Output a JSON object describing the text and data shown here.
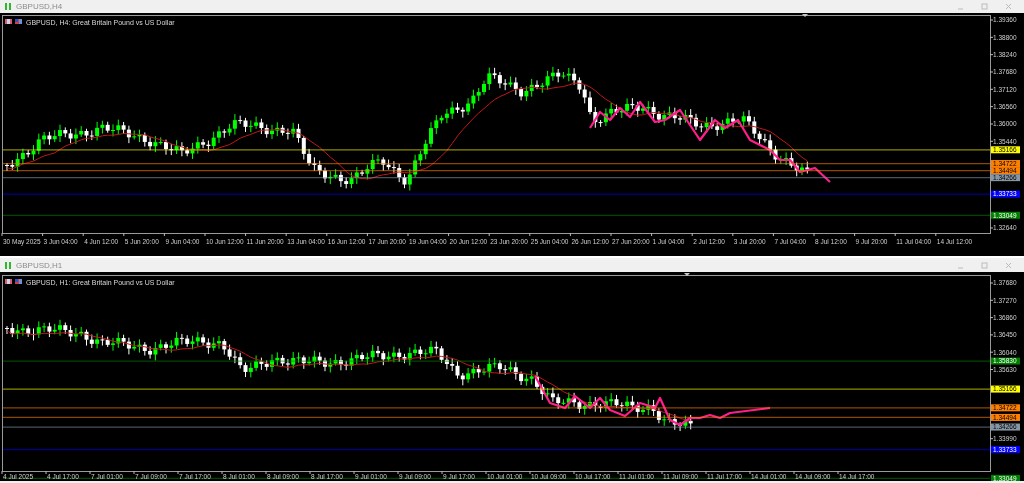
{
  "windows": [
    {
      "title": "GBPUSD,H4",
      "symbol_label": "GBPUSD, H4:  Great Britain Pound vs US Dollar",
      "price_axis": [
        "1.39360",
        "1.38800",
        "1.38240",
        "1.37680",
        "1.37120",
        "1.36560",
        "1.36000",
        "1.35440",
        "1.32640"
      ],
      "levels": [
        {
          "price": "1.35166",
          "color": "#ffff00"
        },
        {
          "price": "1.34722",
          "color": "#ff8000"
        },
        {
          "price": "1.34494",
          "color": "#ff8000"
        },
        {
          "price": "1.34266",
          "color": "#8796a5"
        },
        {
          "price": "1.33733",
          "color": "#0000ff"
        },
        {
          "price": "1.33049",
          "color": "#008000"
        }
      ],
      "time_axis": [
        "30 May 2025",
        "3 Jun 04:00",
        "4 Jun 12:00",
        "5 Jun 20:00",
        "9 Jun 04:00",
        "10 Jun 12:00",
        "11 Jun 20:00",
        "13 Jun 04:00",
        "16 Jun 12:00",
        "17 Jun 20:00",
        "19 Jun 04:00",
        "20 Jun 12:00",
        "23 Jun 20:00",
        "25 Jun 04:00",
        "26 Jun 12:00",
        "27 Jun 20:00",
        "1 Jul 04:00",
        "2 Jul 12:00",
        "3 Jul 20:00",
        "7 Jul 04:00",
        "8 Jul 12:00",
        "9 Jul 20:00",
        "11 Jul 04:00",
        "14 Jul 12:00"
      ]
    },
    {
      "title": "GBPUSD,H1",
      "symbol_label": "GBPUSD, H1:  Great Britain Pound vs US Dollar",
      "price_axis": [
        "1.37680",
        "1.37270",
        "1.36860",
        "1.36450",
        "1.36040",
        "1.35630",
        "1.33990"
      ],
      "levels": [
        {
          "price": "1.35830",
          "color": "#008000"
        },
        {
          "price": "1.35166",
          "color": "#ffff00"
        },
        {
          "price": "1.34722",
          "color": "#ff8000"
        },
        {
          "price": "1.34494",
          "color": "#ff8000"
        },
        {
          "price": "1.34266",
          "color": "#8796a5"
        },
        {
          "price": "1.33733",
          "color": "#0000ff"
        },
        {
          "price": "1.33049",
          "color": "#008000"
        }
      ],
      "time_axis": [
        "4 Jul 2025",
        "4 Jul 17:00",
        "7 Jul 01:00",
        "7 Jul 09:00",
        "7 Jul 17:00",
        "8 Jul 01:00",
        "8 Jul 09:00",
        "8 Jul 17:00",
        "9 Jul 01:00",
        "9 Jul 09:00",
        "9 Jul 17:00",
        "10 Jul 01:00",
        "10 Jul 09:00",
        "10 Jul 17:00",
        "11 Jul 01:00",
        "11 Jul 09:00",
        "11 Jul 17:00",
        "14 Jul 01:00",
        "14 Jul 09:00",
        "14 Jul 17:00"
      ]
    }
  ]
}
